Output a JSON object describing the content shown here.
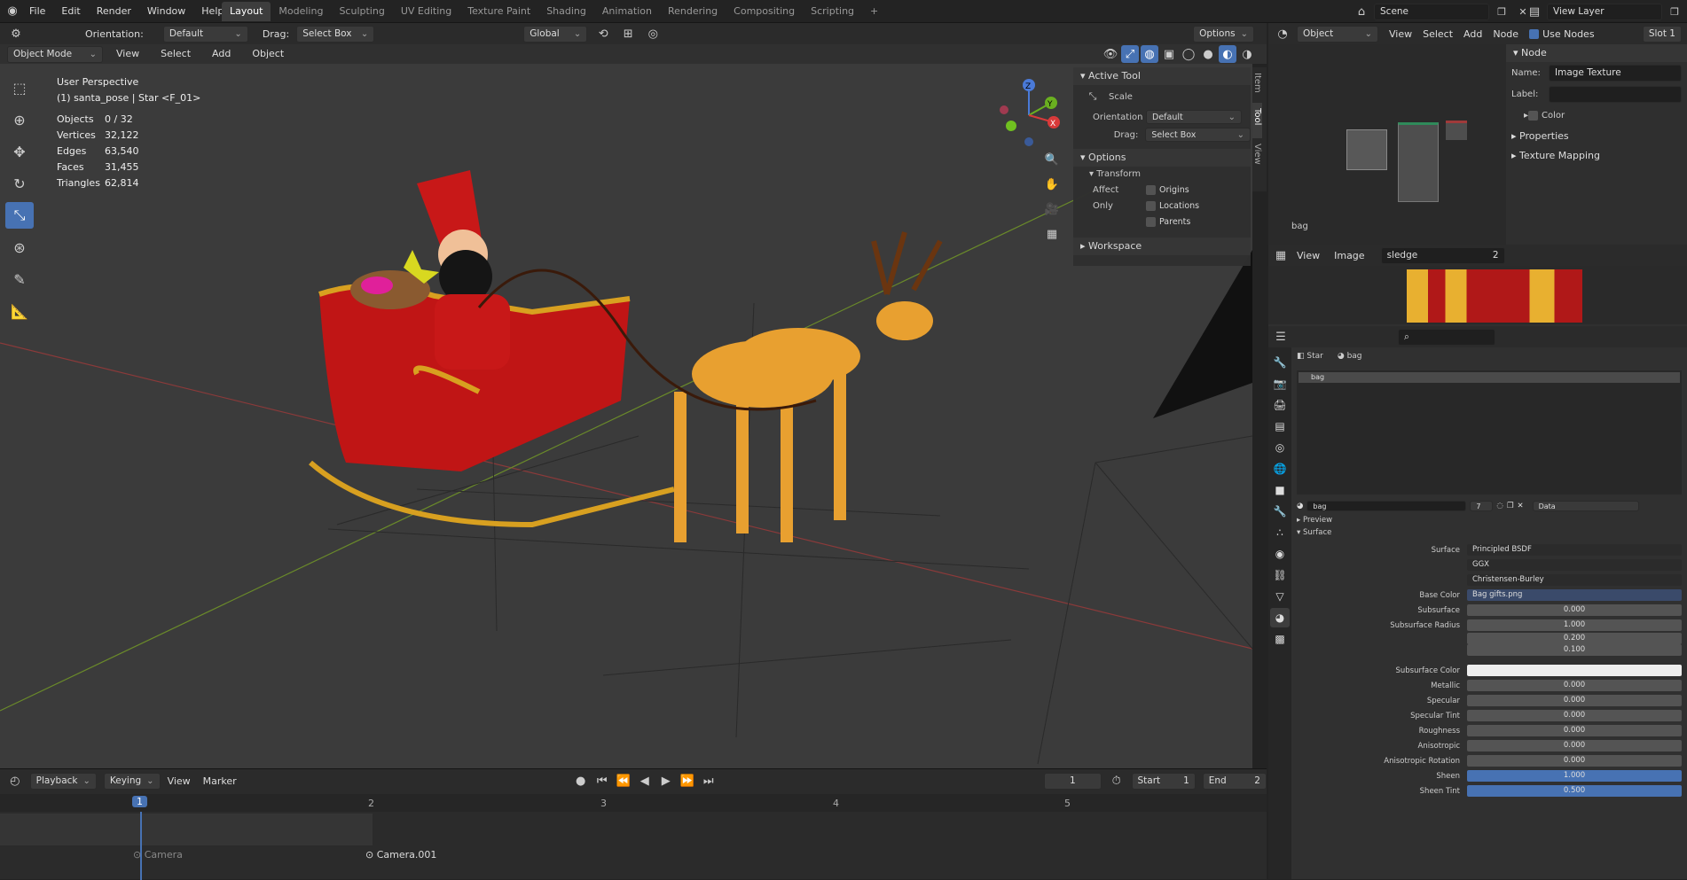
{
  "topbar": {
    "menus": [
      "File",
      "Edit",
      "Render",
      "Window",
      "Help"
    ],
    "workspaces": [
      "Layout",
      "Modeling",
      "Sculpting",
      "UV Editing",
      "Texture Paint",
      "Shading",
      "Animation",
      "Rendering",
      "Compositing",
      "Scripting"
    ],
    "active_workspace": "Layout",
    "add_workspace": "+",
    "scene_label": "Scene",
    "view_layer_label": "View Layer"
  },
  "viewport_header": {
    "orientation_label": "Orientation:",
    "orientation_value": "Default",
    "drag_label": "Drag:",
    "drag_value": "Select Box",
    "transform_space": "Global",
    "options_label": "Options",
    "mode": "Object Mode",
    "menus": [
      "View",
      "Select",
      "Add",
      "Object"
    ]
  },
  "viewport_overlay": {
    "perspective": "User Perspective",
    "object_info": "(1) santa_pose | Star <F_01>",
    "stats": [
      {
        "k": "Objects",
        "v": "0 / 32"
      },
      {
        "k": "Vertices",
        "v": "32,122"
      },
      {
        "k": "Edges",
        "v": "63,540"
      },
      {
        "k": "Faces",
        "v": "31,455"
      },
      {
        "k": "Triangles",
        "v": "62,814"
      }
    ],
    "gizmo_axes": {
      "z": "Z",
      "y": "Y",
      "x": "X"
    }
  },
  "n_panel": {
    "tabs": [
      "Item",
      "Tool",
      "View"
    ],
    "active_tool_title": "Active Tool",
    "tool_name": "Scale",
    "orientation_label": "Orientation",
    "orientation_value": "Default",
    "drag_label": "Drag:",
    "drag_value": "Select Box",
    "options_title": "Options",
    "transform_title": "Transform",
    "affect_only_label": "Affect Only",
    "affect_only": [
      "Origins",
      "Locations",
      "Parents"
    ],
    "workspace_title": "Workspace"
  },
  "timeline": {
    "menus": [
      "Playback",
      "Keying",
      "View",
      "Marker"
    ],
    "current_frame": "1",
    "start_label": "Start",
    "start_value": "1",
    "end_label": "End",
    "end_value": "2",
    "ruler": [
      "1",
      "2",
      "3",
      "4",
      "5"
    ],
    "markers": [
      "Camera",
      "Camera.001"
    ]
  },
  "node_editor": {
    "object_label": "Object",
    "menus": [
      "View",
      "Select",
      "Add",
      "Node"
    ],
    "use_nodes_label": "Use Nodes",
    "slot_label": "Slot 1",
    "node_panel_title": "Node",
    "name_label": "Name:",
    "name_value": "Image Texture",
    "label_label": "Label:",
    "color_label": "Color",
    "properties_label": "Properties",
    "texture_mapping_label": "Texture Mapping",
    "material_name": "bag"
  },
  "image_editor": {
    "menus": [
      "View",
      "Image"
    ],
    "image_name": "sledge",
    "users": "2"
  },
  "properties": {
    "search_placeholder": "",
    "breadcrumb": [
      "Star",
      "bag"
    ],
    "slot_item": "bag",
    "material_name": "bag",
    "material_users": "7",
    "data_label": "Data",
    "preview_label": "Preview",
    "surface_section": "Surface",
    "rows": [
      {
        "label": "Surface",
        "value": "Principled BSDF",
        "style": "dark"
      },
      {
        "label": "",
        "value": "GGX",
        "style": "dark"
      },
      {
        "label": "",
        "value": "Christensen-Burley",
        "style": "dark"
      },
      {
        "label": "Base Color",
        "value": "Bag gifts.png",
        "style": "dark"
      },
      {
        "label": "Subsurface",
        "value": "0.000",
        "style": "num"
      },
      {
        "label": "Subsurface Radius",
        "value": "1.000",
        "style": "num"
      },
      {
        "label": "",
        "value": "0.200",
        "style": "num"
      },
      {
        "label": "",
        "value": "0.100",
        "style": "num"
      },
      {
        "label": "Subsurface Color",
        "value": "",
        "style": "white"
      },
      {
        "label": "Metallic",
        "value": "0.000",
        "style": "num"
      },
      {
        "label": "Specular",
        "value": "0.000",
        "style": "num"
      },
      {
        "label": "Specular Tint",
        "value": "0.000",
        "style": "num"
      },
      {
        "label": "Roughness",
        "value": "0.000",
        "style": "num"
      },
      {
        "label": "Anisotropic",
        "value": "0.000",
        "style": "num"
      },
      {
        "label": "Anisotropic Rotation",
        "value": "0.000",
        "style": "num"
      },
      {
        "label": "Sheen",
        "value": "1.000",
        "style": "blue"
      },
      {
        "label": "Sheen Tint",
        "value": "0.500",
        "style": "blue"
      }
    ]
  }
}
